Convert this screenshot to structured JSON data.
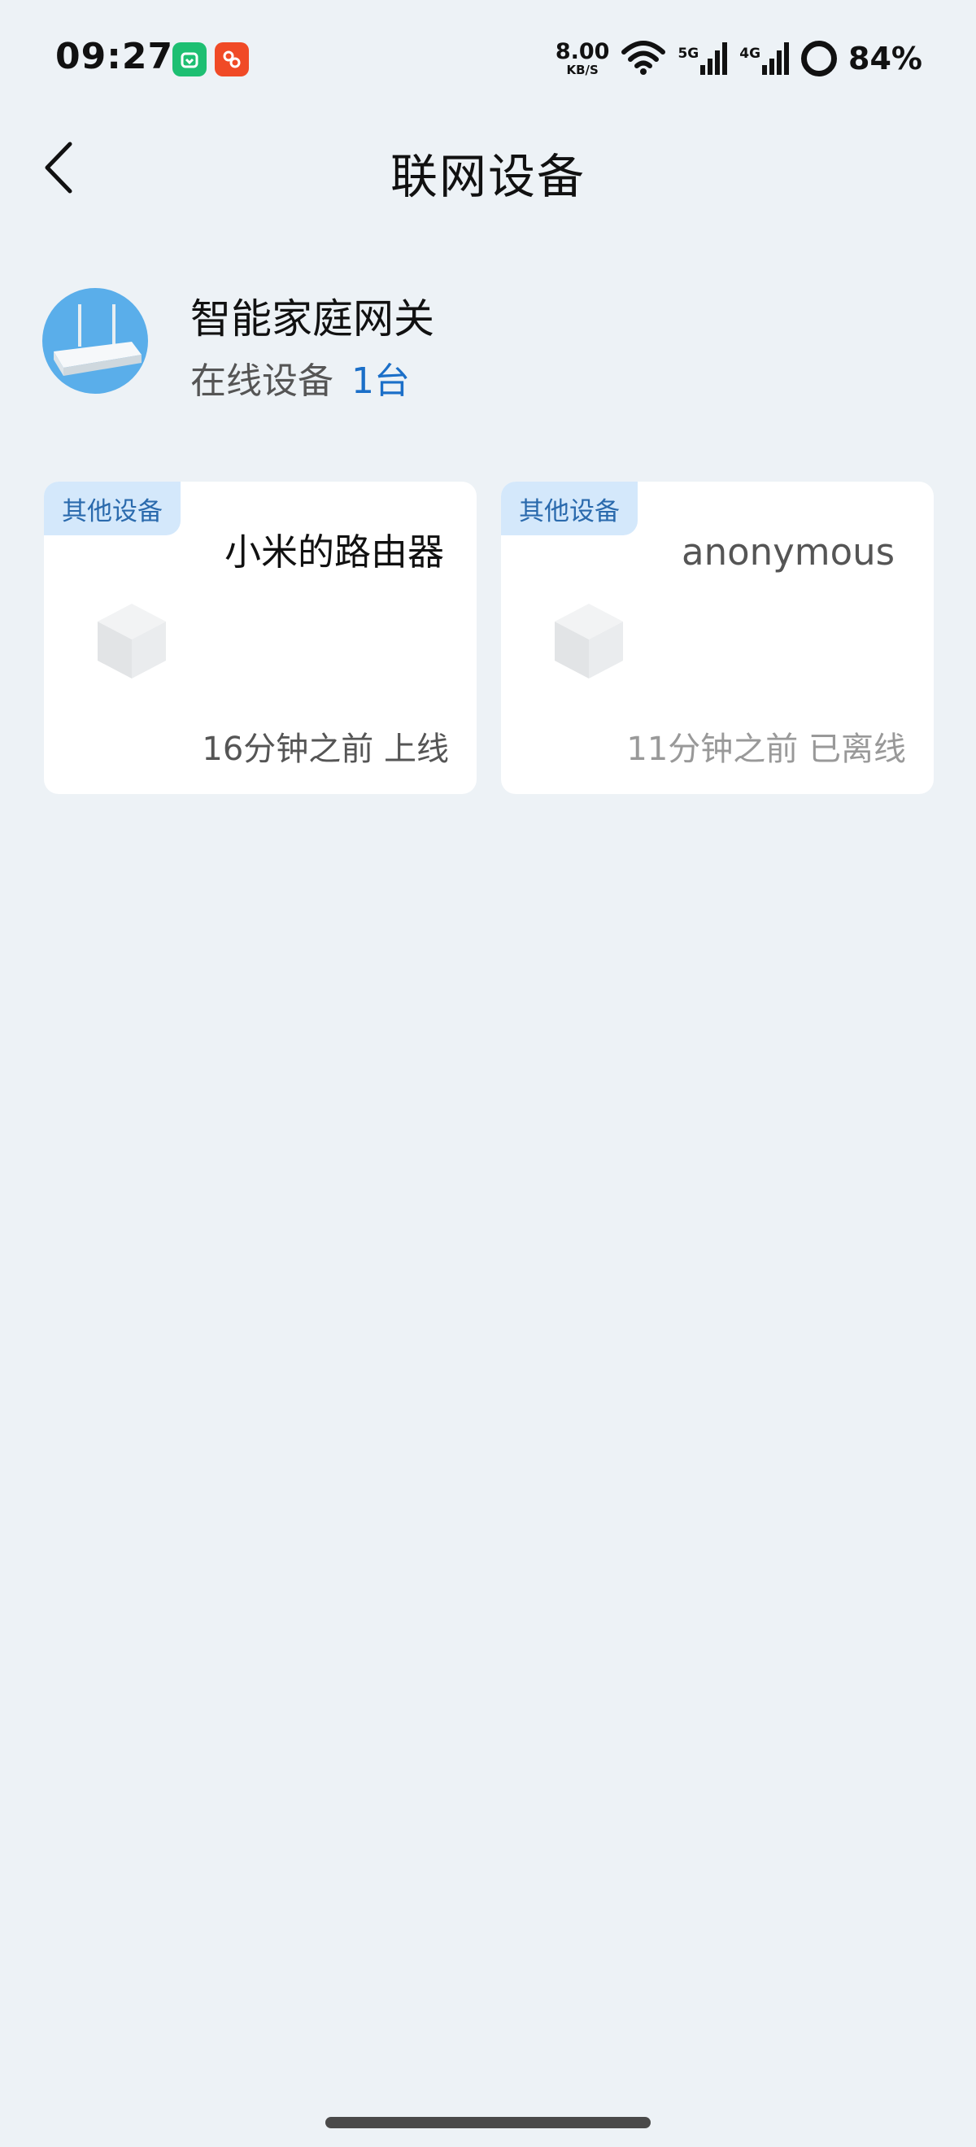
{
  "status_bar": {
    "time": "09:27",
    "net_speed": "8.00",
    "net_unit": "KB/S",
    "signal_1_tag": "5G",
    "signal_2_tag": "4G",
    "battery": "84%",
    "icons": [
      "mi-home-icon",
      "app-notification-icon",
      "wifi-icon",
      "signal-5g-icon",
      "signal-4g-icon",
      "battery-ring-icon"
    ]
  },
  "header": {
    "title": "联网设备",
    "back_icon": "chevron-left-icon"
  },
  "gateway": {
    "name": "智能家庭网关",
    "online_label": "在线设备",
    "online_count": "1台",
    "avatar_icon": "router-icon"
  },
  "devices": [
    {
      "tag": "其他设备",
      "name": "小米的路由器",
      "status": "16分钟之前 上线",
      "icon": "cube-device-icon"
    },
    {
      "tag": "其他设备",
      "name": "anonymous",
      "status": "11分钟之前 已离线",
      "icon": "cube-device-icon"
    }
  ],
  "colors": {
    "background": "#edf2f6",
    "accent": "#1b6fc8",
    "tag_bg": "#d4e8fb",
    "tag_text": "#2a6aad",
    "card_bg": "#ffffff"
  }
}
